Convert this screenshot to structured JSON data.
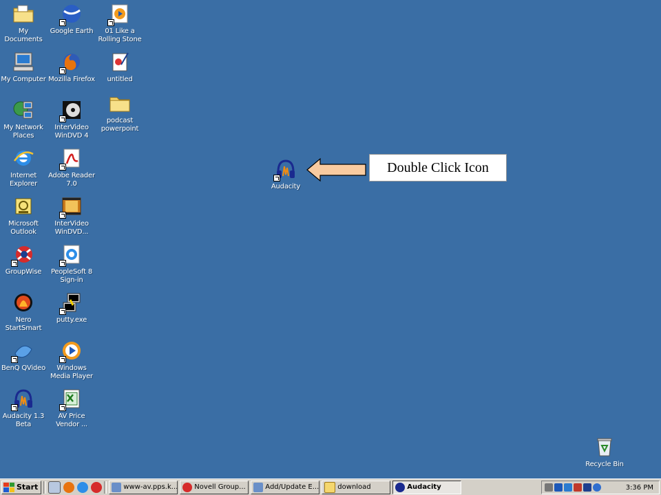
{
  "desktop": {
    "background_color": "#3a6ea5",
    "icons": [
      {
        "label": "My Documents",
        "icon": "folder-documents-icon",
        "shortcut": false
      },
      {
        "label": "Google Earth",
        "icon": "globe-icon",
        "shortcut": true
      },
      {
        "label": "01 Like a Rolling Stone",
        "icon": "media-file-icon",
        "shortcut": true
      },
      {
        "label": "My Computer",
        "icon": "computer-icon",
        "shortcut": false
      },
      {
        "label": "Mozilla Firefox",
        "icon": "firefox-icon",
        "shortcut": true
      },
      {
        "label": "untitled",
        "icon": "document-icon",
        "shortcut": false
      },
      {
        "label": "My Network Places",
        "icon": "network-icon",
        "shortcut": false
      },
      {
        "label": "InterVideo WinDVD 4",
        "icon": "dvd-icon",
        "shortcut": true
      },
      {
        "label": "podcast powerpoint",
        "icon": "folder-icon",
        "shortcut": false
      },
      {
        "label": "Internet Explorer",
        "icon": "ie-icon",
        "shortcut": false
      },
      {
        "label": "Adobe Reader 7.0",
        "icon": "pdf-icon",
        "shortcut": true
      },
      {
        "label": "Microsoft Outlook",
        "icon": "outlook-icon",
        "shortcut": false
      },
      {
        "label": "InterVideo WinDVD...",
        "icon": "film-icon",
        "shortcut": true
      },
      {
        "label": "GroupWise",
        "icon": "groupwise-icon",
        "shortcut": true
      },
      {
        "label": "PeopleSoft 8 Sign-in",
        "icon": "ie-shortcut-icon",
        "shortcut": true
      },
      {
        "label": "Nero StartSmart",
        "icon": "nero-icon",
        "shortcut": false
      },
      {
        "label": "putty.exe",
        "icon": "putty-icon",
        "shortcut": true
      },
      {
        "label": "BenQ QVideo",
        "icon": "benq-icon",
        "shortcut": true
      },
      {
        "label": "Windows Media Player",
        "icon": "media-player-icon",
        "shortcut": true
      },
      {
        "label": "Audacity 1.3 Beta",
        "icon": "audacity-icon",
        "shortcut": true
      },
      {
        "label": "AV Price Vendor ...",
        "icon": "excel-icon",
        "shortcut": true
      },
      {
        "label": "Audacity",
        "icon": "audacity-icon",
        "shortcut": true
      },
      {
        "label": "Recycle Bin",
        "icon": "recycle-bin-icon",
        "shortcut": false
      }
    ]
  },
  "callout": {
    "text": "Double Click Icon",
    "arrow_color": "#f9cba0"
  },
  "taskbar": {
    "start_label": "Start",
    "quick_launch": [
      "desktop-icon",
      "firefox-icon",
      "ie-icon",
      "groupwise-icon"
    ],
    "tasks": [
      {
        "label": "www-av.pps.k...",
        "icon": "window-icon",
        "active": false
      },
      {
        "label": "Novell Group...",
        "icon": "groupwise-icon",
        "active": false
      },
      {
        "label": "Add/Update E...",
        "icon": "window-icon",
        "active": false
      },
      {
        "label": "download",
        "icon": "folder-icon",
        "active": false
      },
      {
        "label": "Audacity",
        "icon": "audacity-icon",
        "active": true
      }
    ],
    "clock": "3:36 PM"
  }
}
